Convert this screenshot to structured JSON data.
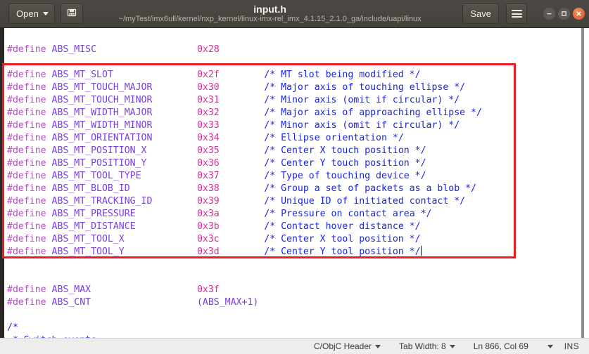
{
  "window": {
    "title": "input.h",
    "path": "~/myTest/imx6ull/kernel/nxp_kernel/linux-imx-rel_imx_4.1.15_2.1.0_ga/include/uapi/linux"
  },
  "toolbar": {
    "open_label": "Open",
    "open_icon": "chevron-down-icon",
    "new_doc_icon": "save-as-document-icon",
    "save_label": "Save",
    "menu_icon": "hamburger-menu-icon",
    "minimize_icon": "minimize-icon",
    "maximize_icon": "maximize-icon",
    "close_icon": "close-icon"
  },
  "annotation": {
    "color": "#ee1c20",
    "shape": "rectangle"
  },
  "colors": {
    "titlebar_bg": "#494640",
    "editor_bg": "#ffffff",
    "gutter_bg": "#2b2925",
    "statusbar_bg": "#efedeb",
    "keyword": "#c642d6",
    "identifier": "#7a3fe0",
    "number": "#e0279a",
    "comment": "#1a24e8",
    "close_button": "#e8693a"
  },
  "editor": {
    "lines": [
      {
        "blank": true
      },
      {
        "kw": "#define",
        "id": "ABS_MISC",
        "num": "0x28",
        "cmt": ""
      },
      {
        "blank": true
      },
      {
        "kw": "#define",
        "id": "ABS_MT_SLOT",
        "num": "0x2f",
        "cmt": "/* MT slot being modified */"
      },
      {
        "kw": "#define",
        "id": "ABS_MT_TOUCH_MAJOR",
        "num": "0x30",
        "cmt": "/* Major axis of touching ellipse */"
      },
      {
        "kw": "#define",
        "id": "ABS_MT_TOUCH_MINOR",
        "num": "0x31",
        "cmt": "/* Minor axis (omit if circular) */"
      },
      {
        "kw": "#define",
        "id": "ABS_MT_WIDTH_MAJOR",
        "num": "0x32",
        "cmt": "/* Major axis of approaching ellipse */"
      },
      {
        "kw": "#define",
        "id": "ABS_MT_WIDTH_MINOR",
        "num": "0x33",
        "cmt": "/* Minor axis (omit if circular) */"
      },
      {
        "kw": "#define",
        "id": "ABS_MT_ORIENTATION",
        "num": "0x34",
        "cmt": "/* Ellipse orientation */"
      },
      {
        "kw": "#define",
        "id": "ABS_MT_POSITION_X",
        "num": "0x35",
        "cmt": "/* Center X touch position */"
      },
      {
        "kw": "#define",
        "id": "ABS_MT_POSITION_Y",
        "num": "0x36",
        "cmt": "/* Center Y touch position */"
      },
      {
        "kw": "#define",
        "id": "ABS_MT_TOOL_TYPE",
        "num": "0x37",
        "cmt": "/* Type of touching device */"
      },
      {
        "kw": "#define",
        "id": "ABS_MT_BLOB_ID",
        "num": "0x38",
        "cmt": "/* Group a set of packets as a blob */"
      },
      {
        "kw": "#define",
        "id": "ABS_MT_TRACKING_ID",
        "num": "0x39",
        "cmt": "/* Unique ID of initiated contact */"
      },
      {
        "kw": "#define",
        "id": "ABS_MT_PRESSURE",
        "num": "0x3a",
        "cmt": "/* Pressure on contact area */"
      },
      {
        "kw": "#define",
        "id": "ABS_MT_DISTANCE",
        "num": "0x3b",
        "cmt": "/* Contact hover distance */"
      },
      {
        "kw": "#define",
        "id": "ABS_MT_TOOL_X",
        "num": "0x3c",
        "cmt": "/* Center X tool position */"
      },
      {
        "kw": "#define",
        "id": "ABS_MT_TOOL_Y",
        "num": "0x3d",
        "cmt": "/* Center Y tool position */",
        "cursor": true
      },
      {
        "blank": true
      },
      {
        "blank": true
      },
      {
        "kw": "#define",
        "id": "ABS_MAX",
        "num": "0x3f",
        "cmt": ""
      },
      {
        "kw": "#define",
        "id": "ABS_CNT",
        "expr": "(ABS_MAX+1)",
        "cmt": ""
      },
      {
        "blank": true
      },
      {
        "cmt_only": "/*"
      },
      {
        "cmt_only": " * Switch events"
      }
    ]
  },
  "statusbar": {
    "language": "C/ObjC Header",
    "tab_width": "Tab Width: 8",
    "position": "Ln 866, Col 69",
    "insert_mode": "INS"
  }
}
